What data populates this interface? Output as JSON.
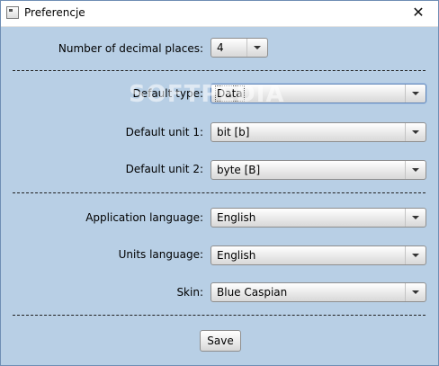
{
  "window": {
    "title": "Preferencje",
    "close_glyph": "✕"
  },
  "form": {
    "decimal_places": {
      "label": "Number of decimal places:",
      "value": "4"
    },
    "default_type": {
      "label": "Default type:",
      "value": "Data"
    },
    "default_unit_1": {
      "label": "Default unit 1:",
      "value": "bit [b]"
    },
    "default_unit_2": {
      "label": "Default unit 2:",
      "value": "byte [B]"
    },
    "application_language": {
      "label": "Application language:",
      "value": "English"
    },
    "units_language": {
      "label": "Units language:",
      "value": "English"
    },
    "skin": {
      "label": "Skin:",
      "value": "Blue Caspian"
    }
  },
  "actions": {
    "save_label": "Save"
  },
  "watermark": "SOFTPEDIA",
  "colors": {
    "background": "#b8cfe5",
    "title_bar": "#ffffff",
    "focus_ring": "#5e84b6"
  }
}
